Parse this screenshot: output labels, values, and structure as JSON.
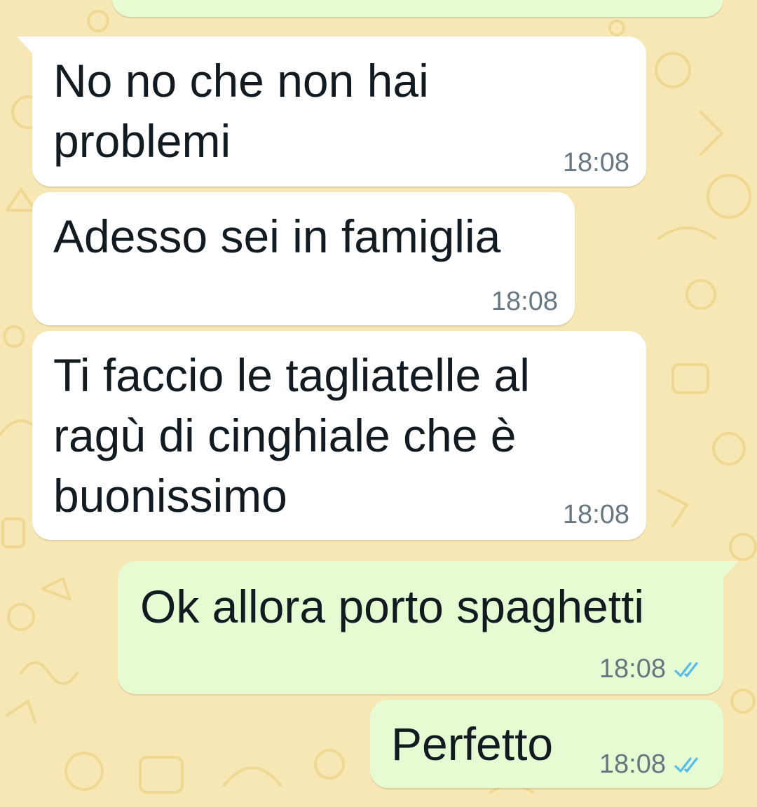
{
  "chat": {
    "messages": [
      {
        "direction": "incoming",
        "text": "No no che non hai\nproblemi",
        "time": "18:08"
      },
      {
        "direction": "incoming",
        "text": "Adesso sei in famiglia",
        "time": "18:08"
      },
      {
        "direction": "incoming",
        "text": "Ti faccio le tagliatelle al\nragù di cinghiale che è\nbuonissimo",
        "time": "18:08"
      },
      {
        "direction": "outgoing",
        "text": "Ok allora porto spaghetti",
        "time": "18:08",
        "status": "read"
      },
      {
        "direction": "outgoing",
        "text": "Perfetto",
        "time": "18:08",
        "status": "read"
      }
    ]
  },
  "colors": {
    "wallpaper": "#f6e7b4",
    "incoming_bubble": "#ffffff",
    "outgoing_bubble": "#e7fbd3",
    "read_ticks": "#53bdeb",
    "timestamp": "#667781"
  }
}
